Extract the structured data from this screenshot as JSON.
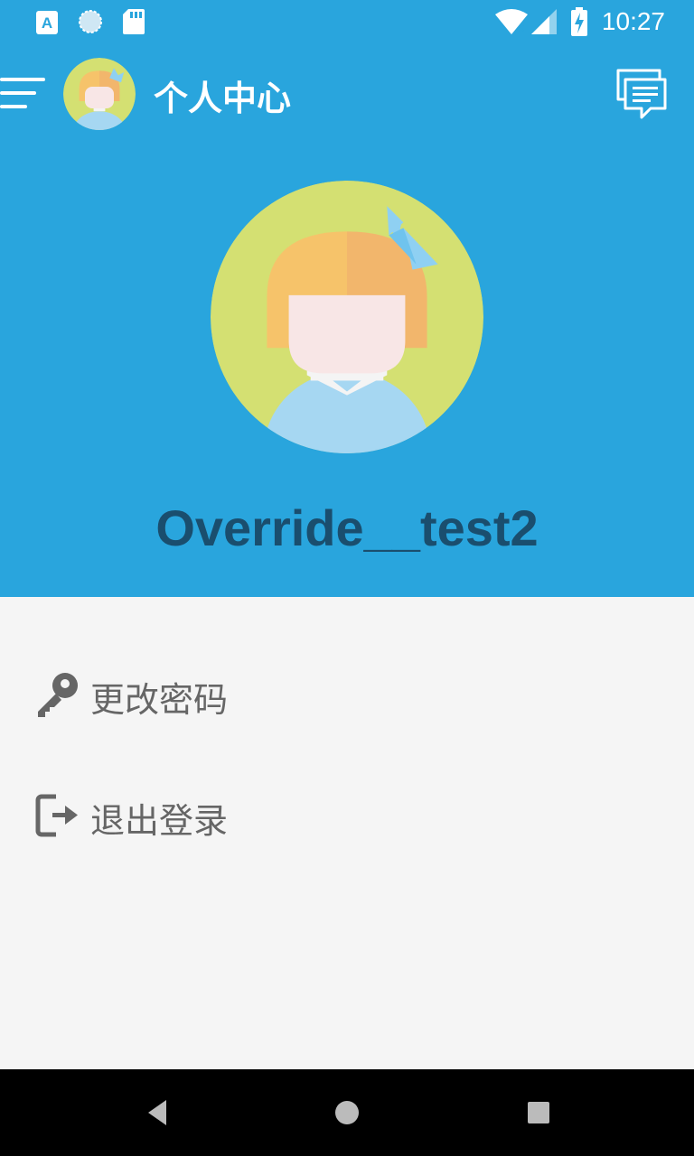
{
  "status_bar": {
    "time": "10:27",
    "icons": [
      "app-a-icon",
      "circle-app-icon",
      "sd-card-icon",
      "wifi-icon",
      "signal-icon",
      "battery-charging-icon"
    ]
  },
  "toolbar": {
    "title": "个人中心",
    "menu_icon": "menu-icon",
    "message_icon": "chat-icon"
  },
  "profile": {
    "username": "Override__test2",
    "avatar_icon": "girl-avatar"
  },
  "menu": {
    "items": [
      {
        "label": "更改密码",
        "icon": "key-icon"
      },
      {
        "label": "退出登录",
        "icon": "logout-icon"
      }
    ]
  },
  "nav_bar": {
    "buttons": [
      "back-icon",
      "home-icon",
      "recents-icon"
    ]
  },
  "colors": {
    "header_bg": "#29a5dd",
    "username": "#1a4e6e",
    "body_bg": "#f5f5f5",
    "menu_text": "#666666"
  }
}
